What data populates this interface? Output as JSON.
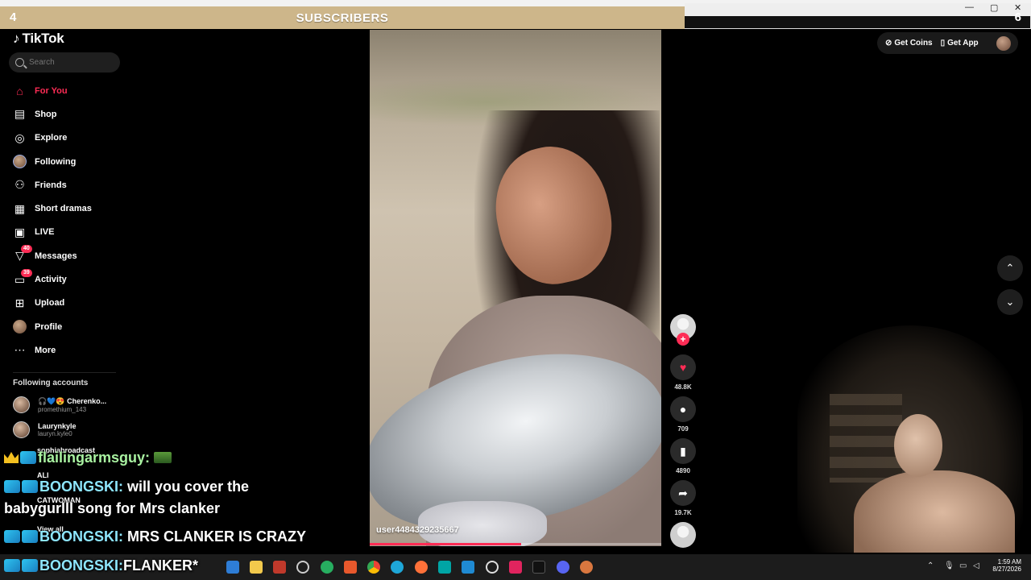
{
  "overlay": {
    "banner_label": "SUBSCRIBERS",
    "left_count": "4",
    "right_count": "6"
  },
  "window_controls": {
    "minimize": "—",
    "maximize": "▢",
    "close": "✕"
  },
  "app": {
    "logo_text": "TikTok",
    "search_placeholder": "Search",
    "nav": [
      {
        "label": "For You",
        "icon": "home-icon",
        "active": true
      },
      {
        "label": "Shop",
        "icon": "shop-icon"
      },
      {
        "label": "Explore",
        "icon": "compass-icon"
      },
      {
        "label": "Following",
        "icon": "following-avatar-icon"
      },
      {
        "label": "Friends",
        "icon": "friends-icon"
      },
      {
        "label": "Short dramas",
        "icon": "film-icon"
      },
      {
        "label": "LIVE",
        "icon": "live-icon"
      },
      {
        "label": "Messages",
        "icon": "send-icon",
        "badge": "40"
      },
      {
        "label": "Activity",
        "icon": "activity-icon",
        "badge": "39"
      },
      {
        "label": "Upload",
        "icon": "upload-icon"
      },
      {
        "label": "Profile",
        "icon": "profile-avatar-icon"
      },
      {
        "label": "More",
        "icon": "more-icon"
      }
    ],
    "following_header": "Following accounts",
    "following_accounts": [
      {
        "name": "🎧💙😍 Cherenko...",
        "handle": "promethium_143"
      },
      {
        "name": "Laurynkyle",
        "handle": "lauryn.kyle0"
      },
      {
        "name": "sophiabroadcast",
        "handle": ""
      },
      {
        "name": "ALI",
        "handle": ""
      },
      {
        "name": "CATWOMAN",
        "handle": ""
      }
    ],
    "view_all": "View all",
    "top_right": {
      "get_coins": "Get Coins",
      "get_app": "Get App"
    }
  },
  "video": {
    "username": "user4484329235667",
    "progress": 0.52,
    "likes": "48.8K",
    "comments": "709",
    "saves": "4890",
    "shares": "19.7K"
  },
  "chat": [
    {
      "user": "flailingarmsguy:",
      "message": ""
    },
    {
      "user": "BOONGSKI:",
      "message": "will you cover the"
    },
    {
      "user": "",
      "message": "babygurlll song for Mrs clanker"
    },
    {
      "user": "BOONGSKI:",
      "message": "MRS CLANKER IS CRAZY"
    },
    {
      "user": "BOONGSKI:",
      "message": "FLANKER*"
    }
  ],
  "taskbar": {
    "time": "1:59 AM",
    "date": "8/27/2026"
  },
  "colors": {
    "accent": "#fe2c55",
    "banner": "#cdb68a"
  }
}
